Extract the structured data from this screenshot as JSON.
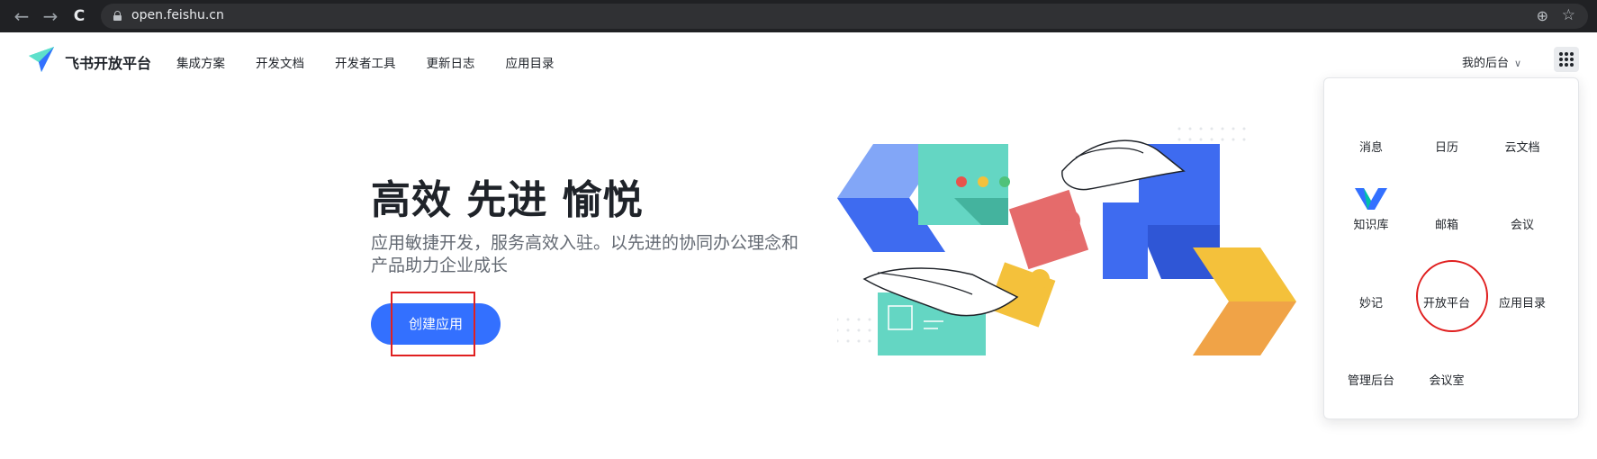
{
  "browser": {
    "url": "open.feishu.cn",
    "back_icon": "←",
    "forward_icon": "→",
    "reload_icon": "C",
    "zoom_icon": "⊕",
    "star_icon": "☆"
  },
  "header": {
    "brand": "飞书开放平台",
    "nav": [
      "集成方案",
      "开发文档",
      "开发者工具",
      "更新日志",
      "应用目录"
    ],
    "console_menu": "我的后台",
    "chevron": "∨"
  },
  "hero": {
    "title": "高效 先进 愉悦",
    "subtitle": "应用敏捷开发，服务高效入驻。以先进的协同办公理念和产品助力企业成长",
    "create_button": "创建应用"
  },
  "apps_panel": {
    "items": [
      "消息",
      "日历",
      "云文档",
      "知识库",
      "邮箱",
      "会议",
      "妙记",
      "开放平台",
      "应用目录",
      "管理后台",
      "会议室"
    ]
  },
  "colors": {
    "accent": "#3370ff",
    "highlight": "#e02020"
  }
}
